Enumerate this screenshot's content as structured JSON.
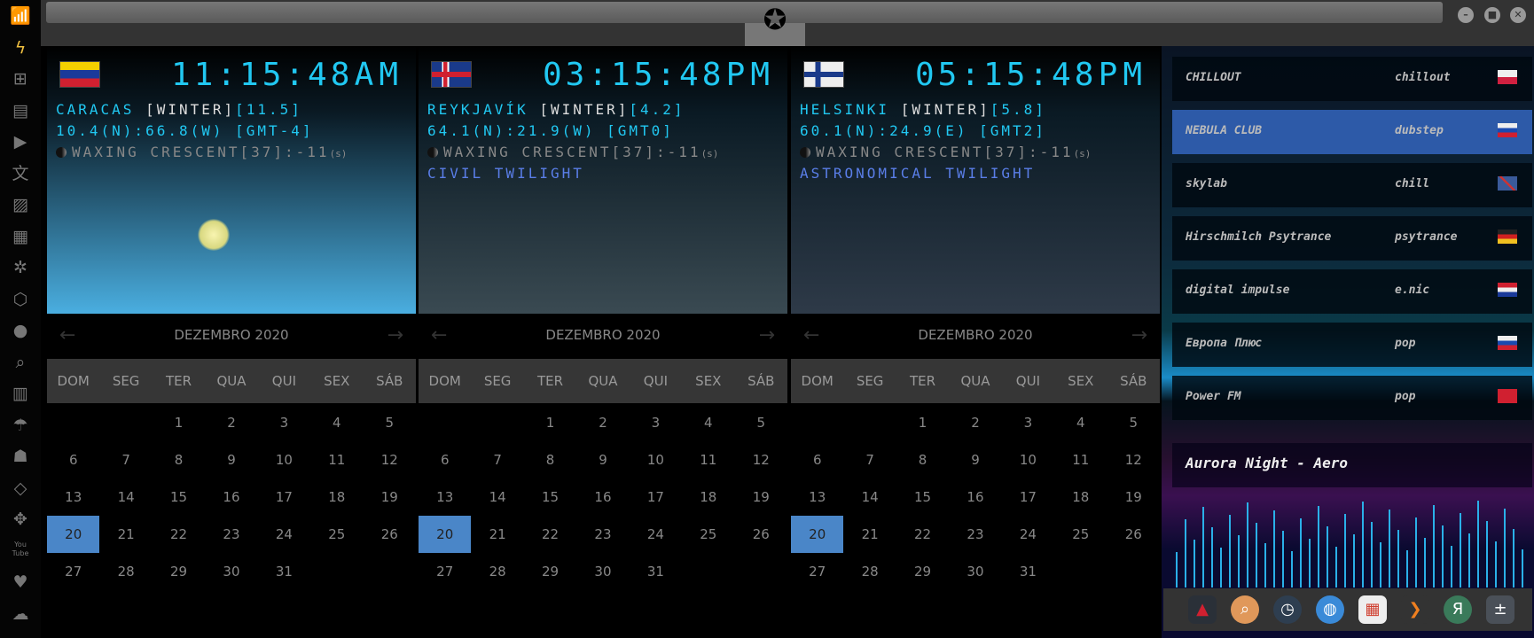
{
  "sidebar": {
    "icons": [
      "wifi-icon",
      "lightning-icon",
      "windows-icon",
      "archive-icon",
      "play-icon",
      "translate-icon",
      "image-icon",
      "news-icon",
      "empire-icon",
      "hexagon-icon",
      "globe-icon",
      "search-icon",
      "map-icon",
      "umbrella-icon",
      "contacts-icon",
      "link-icon",
      "expand-icon",
      "youtube-icon",
      "heart-icon",
      "cloud-icon"
    ],
    "youtube_label": "You Tube"
  },
  "window": {
    "controls": [
      "minimize",
      "maximize",
      "close"
    ]
  },
  "clocks": [
    {
      "flag": "venezuela",
      "time": "11:15:48",
      "ampm": "AM",
      "city": "CARACAS ",
      "season": "[WINTER]",
      "temp": "[11.5]",
      "coords": "10.4(N):66.8(W) [GMT-4]",
      "moon": "WAXING CRESCENT[37]:-11",
      "moon_unit": "(s)",
      "twilight": "",
      "bg": "#4aaee0"
    },
    {
      "flag": "iceland",
      "time": "03:15:48",
      "ampm": "PM",
      "city": "REYKJAVÍK ",
      "season": "[WINTER]",
      "temp": "[4.2]",
      "coords": "64.1(N):21.9(W) [GMT0]",
      "moon": "WAXING CRESCENT[37]:-11",
      "moon_unit": "(s)",
      "twilight": "CIVIL TWILIGHT",
      "bg": "#3a4a52"
    },
    {
      "flag": "finland",
      "time": "05:15:48",
      "ampm": "PM",
      "city": "HELSINKI ",
      "season": "[WINTER]",
      "temp": "[5.8]",
      "coords": "60.1(N):24.9(E) [GMT2]",
      "moon": "WAXING CRESCENT[37]:-11",
      "moon_unit": "(s)",
      "twilight": "ASTRONOMICAL TWILIGHT",
      "bg": "#2e3a48"
    }
  ],
  "calendar": {
    "month": "DEZEMBRO 2020",
    "weekdays": [
      "DOM",
      "SEG",
      "TER",
      "QUA",
      "QUI",
      "SEX",
      "SÁB"
    ],
    "weeks": [
      [
        "",
        "",
        "1",
        "2",
        "3",
        "4",
        "5"
      ],
      [
        "6",
        "7",
        "8",
        "9",
        "10",
        "11",
        "12"
      ],
      [
        "13",
        "14",
        "15",
        "16",
        "17",
        "18",
        "19"
      ],
      [
        "20",
        "21",
        "22",
        "23",
        "24",
        "25",
        "26"
      ],
      [
        "27",
        "28",
        "29",
        "30",
        "31",
        "",
        ""
      ]
    ],
    "today": "20"
  },
  "radio": {
    "stations": [
      {
        "name": "CHILLOUT",
        "genre": "chillout",
        "flag": "poland"
      },
      {
        "name": "NEBULA CLUB",
        "genre": "dubstep",
        "flag": "russia",
        "selected": true
      },
      {
        "name": "skylab",
        "genre": "chill",
        "flag": "uk"
      },
      {
        "name": "Hirschmilch Psytrance",
        "genre": "psytrance",
        "flag": "germany"
      },
      {
        "name": "digital impulse",
        "genre": "e.nic",
        "flag": "croatia"
      },
      {
        "name": "Европа Плюс",
        "genre": "pop",
        "flag": "russia"
      },
      {
        "name": "Power FM",
        "genre": "pop",
        "flag": "turkey"
      }
    ],
    "now_playing": "Aurora Night - Aero"
  },
  "dock": [
    {
      "name": "arrow-app-icon",
      "color": "#2a3038"
    },
    {
      "name": "search-app-icon",
      "color": "#e0985a"
    },
    {
      "name": "clock-app-icon",
      "color": "#2e3e50"
    },
    {
      "name": "globe-app-icon",
      "color": "#3a8ad8"
    },
    {
      "name": "calendar-app-icon",
      "color": "#eeeeee"
    },
    {
      "name": "terminal-app-icon",
      "color": "#333333"
    },
    {
      "name": "yandex-app-icon",
      "color": "#3a7a5a"
    },
    {
      "name": "calculator-app-icon",
      "color": "#4a5058"
    }
  ]
}
